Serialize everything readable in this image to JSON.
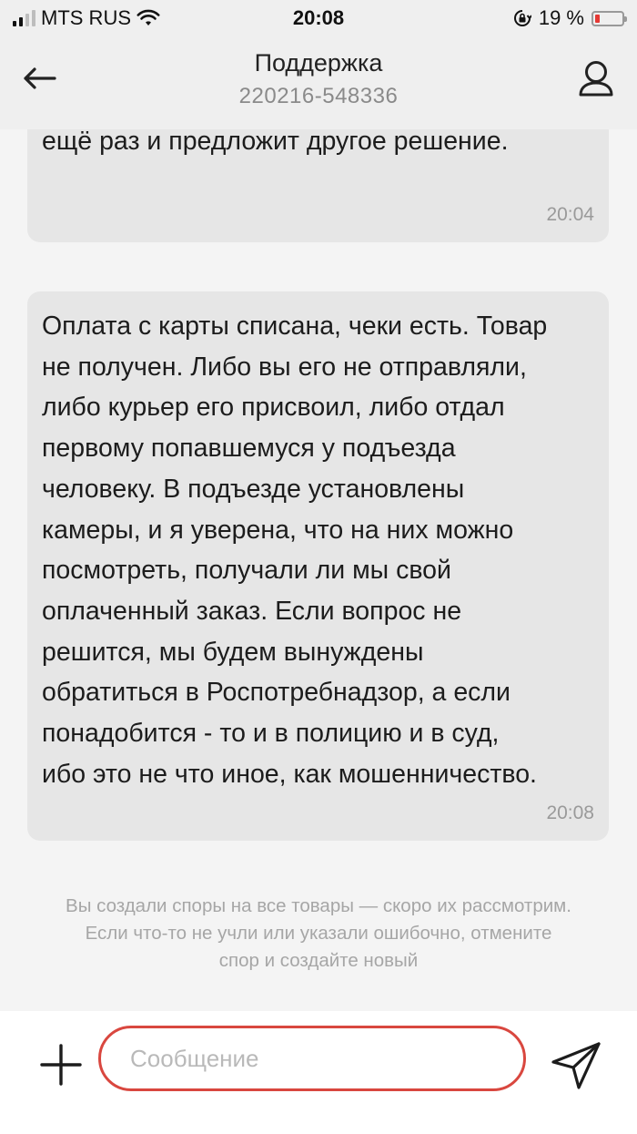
{
  "status_bar": {
    "carrier": "MTS RUS",
    "time": "20:08",
    "battery_percent": "19 %",
    "battery_level": 0.19,
    "battery_color": "#e53935"
  },
  "header": {
    "title": "Поддержка",
    "subtitle": "220216-548336",
    "back_icon": "arrow-left-icon",
    "profile_icon": "user-icon"
  },
  "messages": [
    {
      "text": "Решение отклонено. Магазин изучит спор\nещё раз и предложит другое решение.",
      "time": "20:04"
    },
    {
      "text": "Оплата с карты списана, чеки есть. Товар\nне получен. Либо вы его не отправляли,\nлибо курьер его присвоил, либо отдал\nпервому попавшемуся у подъезда\nчеловеку. В подъезде установлены\nкамеры, и я уверена, что на них можно\nпосмотреть, получали ли мы свой\nоплаченный заказ. Если вопрос не\nрешится, мы будем вынуждены\nобратиться в Роспотребнадзор, а если\nпонадобится - то и в полицию и в суд,\nибо это не что иное, как мошенничество.",
      "time": "20:08"
    }
  ],
  "system_note": "Вы создали споры на все товары — скоро их рассмотрим.\nЕсли что-то не учли или указали ошибочно, отмените\nспор и создайте новый",
  "composer": {
    "placeholder": "Сообщение",
    "value": "",
    "add_icon": "plus-icon",
    "send_icon": "send-icon",
    "accent_color": "#d9473f"
  }
}
